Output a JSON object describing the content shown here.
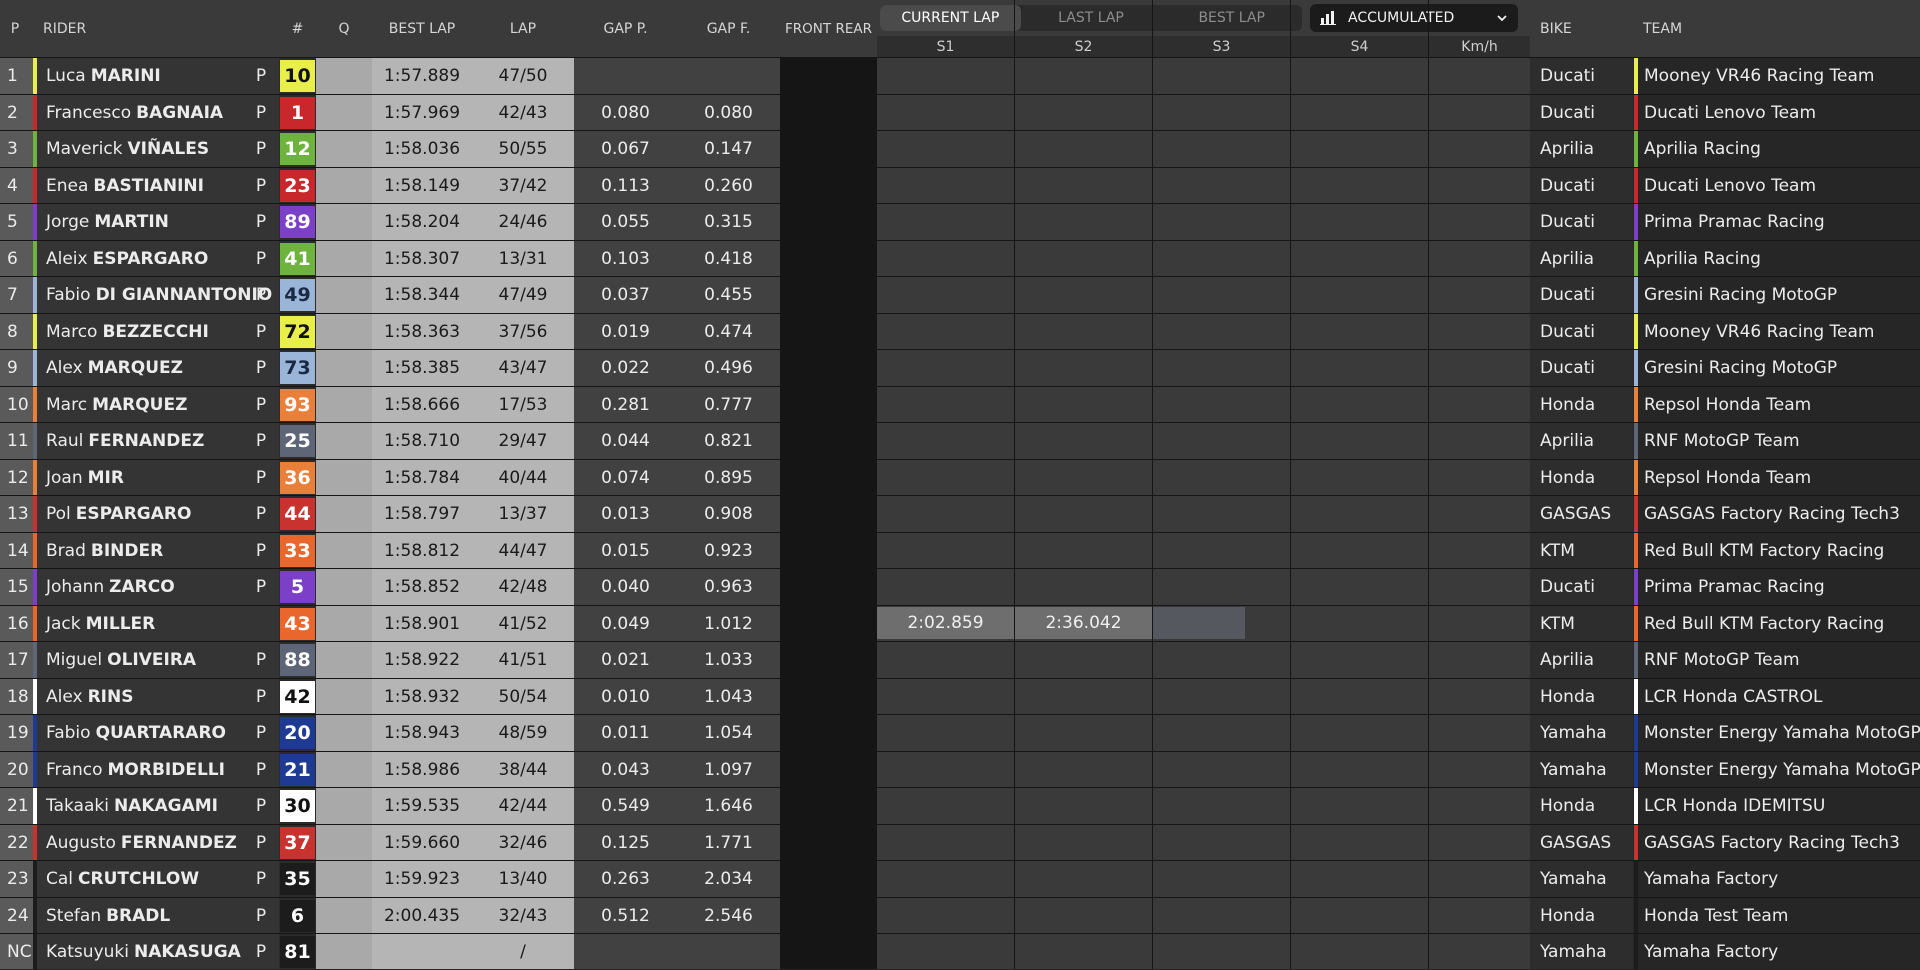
{
  "header": {
    "p": "P",
    "rider": "RIDER",
    "number": "#",
    "q": "Q",
    "best_lap": "BEST LAP",
    "lap": "LAP",
    "gap_p": "GAP P.",
    "gap_f": "GAP F.",
    "front_rear": "FRONT REAR",
    "bike": "BIKE",
    "team": "TEAM"
  },
  "tabs": [
    "CURRENT LAP",
    "LAST LAP",
    "BEST LAP"
  ],
  "active_tab": 0,
  "accumulated": {
    "label": "ACCUMULATED",
    "icon": "bar-chart-icon"
  },
  "sub_headers": [
    "S1",
    "S2",
    "S3",
    "S4",
    "Km/h"
  ],
  "colors": {
    "ducati_lenovo": "#c8282c",
    "vr46": "#e8ee4a",
    "aprilia": "#6fb33f",
    "pramac": "#7b3fc8",
    "gresini": "#9bb5d8",
    "honda_repsol": "#e9803a",
    "rnf": "#5e6577",
    "ktm": "#e9672c",
    "tech3": "#c8322f",
    "yamaha": "#1f3a93",
    "lcr": "#ffffff",
    "rins": "#ffffff"
  },
  "riders": [
    {
      "pos": "1",
      "first": "Luca",
      "last": "MARINI",
      "p": "P",
      "num": "10",
      "best": "1:57.889",
      "lap": "47/50",
      "gap_p": "",
      "gap_f": "",
      "bike": "Ducati",
      "team": "Mooney VR46 Racing Team",
      "color": "#e8ee4a",
      "numText": "#111111"
    },
    {
      "pos": "2",
      "first": "Francesco",
      "last": "BAGNAIA",
      "p": "P",
      "num": "1",
      "best": "1:57.969",
      "lap": "42/43",
      "gap_p": "0.080",
      "gap_f": "0.080",
      "bike": "Ducati",
      "team": "Ducati Lenovo Team",
      "color": "#c8282c",
      "numText": "#ffffff"
    },
    {
      "pos": "3",
      "first": "Maverick",
      "last": "VIÑALES",
      "p": "P",
      "num": "12",
      "best": "1:58.036",
      "lap": "50/55",
      "gap_p": "0.067",
      "gap_f": "0.147",
      "bike": "Aprilia",
      "team": "Aprilia Racing",
      "color": "#6fb33f",
      "numText": "#ffffff"
    },
    {
      "pos": "4",
      "first": "Enea",
      "last": "BASTIANINI",
      "p": "P",
      "num": "23",
      "best": "1:58.149",
      "lap": "37/42",
      "gap_p": "0.113",
      "gap_f": "0.260",
      "bike": "Ducati",
      "team": "Ducati Lenovo Team",
      "color": "#c8282c",
      "numText": "#ffffff"
    },
    {
      "pos": "5",
      "first": "Jorge",
      "last": "MARTIN",
      "p": "P",
      "num": "89",
      "best": "1:58.204",
      "lap": "24/46",
      "gap_p": "0.055",
      "gap_f": "0.315",
      "bike": "Ducati",
      "team": "Prima Pramac Racing",
      "color": "#7b3fc8",
      "numText": "#ffffff"
    },
    {
      "pos": "6",
      "first": "Aleix",
      "last": "ESPARGARO",
      "p": "P",
      "num": "41",
      "best": "1:58.307",
      "lap": "13/31",
      "gap_p": "0.103",
      "gap_f": "0.418",
      "bike": "Aprilia",
      "team": "Aprilia Racing",
      "color": "#6fb33f",
      "numText": "#ffffff"
    },
    {
      "pos": "7",
      "first": "Fabio",
      "last": "DI GIANNANTONIO",
      "p": "P",
      "num": "49",
      "best": "1:58.344",
      "lap": "47/49",
      "gap_p": "0.037",
      "gap_f": "0.455",
      "bike": "Ducati",
      "team": "Gresini Racing MotoGP",
      "color": "#9bb5d8",
      "numText": "#1a2a44"
    },
    {
      "pos": "8",
      "first": "Marco",
      "last": "BEZZECCHI",
      "p": "P",
      "num": "72",
      "best": "1:58.363",
      "lap": "37/56",
      "gap_p": "0.019",
      "gap_f": "0.474",
      "bike": "Ducati",
      "team": "Mooney VR46 Racing Team",
      "color": "#e8ee4a",
      "numText": "#111111"
    },
    {
      "pos": "9",
      "first": "Alex",
      "last": "MARQUEZ",
      "p": "P",
      "num": "73",
      "best": "1:58.385",
      "lap": "43/47",
      "gap_p": "0.022",
      "gap_f": "0.496",
      "bike": "Ducati",
      "team": "Gresini Racing MotoGP",
      "color": "#9bb5d8",
      "numText": "#1a2a44"
    },
    {
      "pos": "10",
      "first": "Marc",
      "last": "MARQUEZ",
      "p": "P",
      "num": "93",
      "best": "1:58.666",
      "lap": "17/53",
      "gap_p": "0.281",
      "gap_f": "0.777",
      "bike": "Honda",
      "team": "Repsol Honda Team",
      "color": "#e9803a",
      "numText": "#ffffff"
    },
    {
      "pos": "11",
      "first": "Raul",
      "last": "FERNANDEZ",
      "p": "P",
      "num": "25",
      "best": "1:58.710",
      "lap": "29/47",
      "gap_p": "0.044",
      "gap_f": "0.821",
      "bike": "Aprilia",
      "team": "RNF MotoGP Team",
      "color": "#5e6577",
      "numText": "#ffffff"
    },
    {
      "pos": "12",
      "first": "Joan",
      "last": "MIR",
      "p": "P",
      "num": "36",
      "best": "1:58.784",
      "lap": "40/44",
      "gap_p": "0.074",
      "gap_f": "0.895",
      "bike": "Honda",
      "team": "Repsol Honda Team",
      "color": "#e9803a",
      "numText": "#ffffff"
    },
    {
      "pos": "13",
      "first": "Pol",
      "last": "ESPARGARO",
      "p": "P",
      "num": "44",
      "best": "1:58.797",
      "lap": "13/37",
      "gap_p": "0.013",
      "gap_f": "0.908",
      "bike": "GASGAS",
      "team": "GASGAS Factory Racing Tech3",
      "color": "#c8322f",
      "numText": "#ffffff"
    },
    {
      "pos": "14",
      "first": "Brad",
      "last": "BINDER",
      "p": "P",
      "num": "33",
      "best": "1:58.812",
      "lap": "44/47",
      "gap_p": "0.015",
      "gap_f": "0.923",
      "bike": "KTM",
      "team": "Red Bull KTM Factory Racing",
      "color": "#e9672c",
      "numText": "#ffffff"
    },
    {
      "pos": "15",
      "first": "Johann",
      "last": "ZARCO",
      "p": "P",
      "num": "5",
      "best": "1:58.852",
      "lap": "42/48",
      "gap_p": "0.040",
      "gap_f": "0.963",
      "bike": "Ducati",
      "team": "Prima Pramac Racing",
      "color": "#7b3fc8",
      "numText": "#ffffff"
    },
    {
      "pos": "16",
      "first": "Jack",
      "last": "MILLER",
      "p": "",
      "num": "43",
      "best": "1:58.901",
      "lap": "41/52",
      "gap_p": "0.049",
      "gap_f": "1.012",
      "bike": "KTM",
      "team": "Red Bull KTM Factory Racing",
      "color": "#e9672c",
      "numText": "#ffffff",
      "s1": "2:02.859",
      "s2": "2:36.042",
      "s3": ""
    },
    {
      "pos": "17",
      "first": "Miguel",
      "last": "OLIVEIRA",
      "p": "P",
      "num": "88",
      "best": "1:58.922",
      "lap": "41/51",
      "gap_p": "0.021",
      "gap_f": "1.033",
      "bike": "Aprilia",
      "team": "RNF MotoGP Team",
      "color": "#5e6577",
      "numText": "#ffffff"
    },
    {
      "pos": "18",
      "first": "Alex",
      "last": "RINS",
      "p": "P",
      "num": "42",
      "best": "1:58.932",
      "lap": "50/54",
      "gap_p": "0.010",
      "gap_f": "1.043",
      "bike": "Honda",
      "team": "LCR Honda CASTROL",
      "color": "#ffffff",
      "numText": "#111111"
    },
    {
      "pos": "19",
      "first": "Fabio",
      "last": "QUARTARARO",
      "p": "P",
      "num": "20",
      "best": "1:58.943",
      "lap": "48/59",
      "gap_p": "0.011",
      "gap_f": "1.054",
      "bike": "Yamaha",
      "team": "Monster Energy Yamaha MotoGP",
      "color": "#1f3a93",
      "numText": "#ffffff"
    },
    {
      "pos": "20",
      "first": "Franco",
      "last": "MORBIDELLI",
      "p": "P",
      "num": "21",
      "best": "1:58.986",
      "lap": "38/44",
      "gap_p": "0.043",
      "gap_f": "1.097",
      "bike": "Yamaha",
      "team": "Monster Energy Yamaha MotoGP",
      "color": "#1f3a93",
      "numText": "#ffffff"
    },
    {
      "pos": "21",
      "first": "Takaaki",
      "last": "NAKAGAMI",
      "p": "P",
      "num": "30",
      "best": "1:59.535",
      "lap": "42/44",
      "gap_p": "0.549",
      "gap_f": "1.646",
      "bike": "Honda",
      "team": "LCR Honda IDEMITSU",
      "color": "#ffffff",
      "numText": "#111111"
    },
    {
      "pos": "22",
      "first": "Augusto",
      "last": "FERNANDEZ",
      "p": "P",
      "num": "37",
      "best": "1:59.660",
      "lap": "32/46",
      "gap_p": "0.125",
      "gap_f": "1.771",
      "bike": "GASGAS",
      "team": "GASGAS Factory Racing Tech3",
      "color": "#c8322f",
      "numText": "#ffffff"
    },
    {
      "pos": "23",
      "first": "Cal",
      "last": "CRUTCHLOW",
      "p": "P",
      "num": "35",
      "best": "1:59.923",
      "lap": "13/40",
      "gap_p": "0.263",
      "gap_f": "2.034",
      "bike": "Yamaha",
      "team": "Yamaha Factory",
      "color": "#1c1c1c",
      "numText": "#ffffff"
    },
    {
      "pos": "24",
      "first": "Stefan",
      "last": "BRADL",
      "p": "P",
      "num": "6",
      "best": "2:00.435",
      "lap": "32/43",
      "gap_p": "0.512",
      "gap_f": "2.546",
      "bike": "Honda",
      "team": "Honda Test Team",
      "color": "#1c1c1c",
      "numText": "#ffffff"
    },
    {
      "pos": "NC",
      "first": "Katsuyuki",
      "last": "NAKASUGA",
      "p": "P",
      "num": "81",
      "best": "",
      "lap": "/",
      "gap_p": "",
      "gap_f": "",
      "bike": "Yamaha",
      "team": "Yamaha Factory",
      "color": "#1c1c1c",
      "numText": "#ffffff"
    }
  ]
}
